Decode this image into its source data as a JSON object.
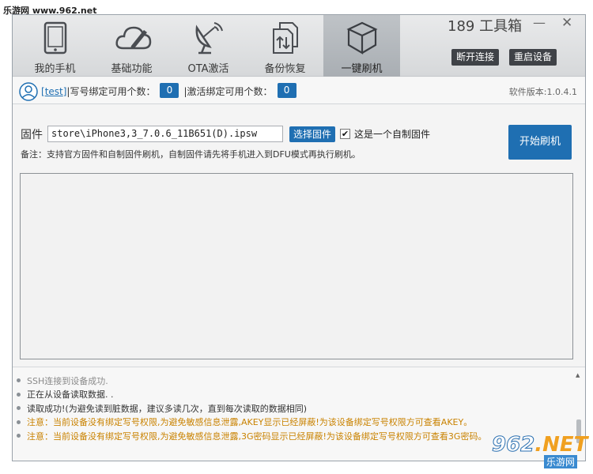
{
  "site_watermark": "乐游网 www.962.net",
  "app": {
    "title": "189 工具箱",
    "minimize_glyph": "—",
    "close_glyph": "✕",
    "disconnect_label": "断开连接",
    "reboot_label": "重启设备"
  },
  "nav": {
    "items": [
      {
        "label": "我的手机",
        "icon": "phone-icon"
      },
      {
        "label": "基础功能",
        "icon": "cloud-pencil-icon"
      },
      {
        "label": "OTA激活",
        "icon": "satellite-dish-icon"
      },
      {
        "label": "备份恢复",
        "icon": "backup-files-icon"
      },
      {
        "label": "一键刷机",
        "icon": "box-icon",
        "active": true
      }
    ]
  },
  "infobar": {
    "bracket_open": "[",
    "username": "test",
    "bracket_close": "]",
    "write_label": "|写号绑定可用个数：",
    "write_count": "0",
    "activate_label": "|激活绑定可用个数：",
    "activate_count": "0",
    "version": "软件版本:1.0.4.1"
  },
  "firmware": {
    "label": "固件",
    "path": "store\\iPhone3,3_7.0.6_11B651(D).ipsw",
    "choose_label": "选择固件",
    "custom_checked": true,
    "check_glyph": "✔",
    "custom_label": "这是一个自制固件",
    "note": "备注：支持官方固件和自制固件刷机，自制固件请先将手机进入到DFU模式再执行刷机。",
    "start_label": "开始刷机"
  },
  "log": [
    {
      "text": "SSH连接到设备成功.",
      "level": "grey"
    },
    {
      "text": "正在从设备读取数据. .",
      "level": "normal"
    },
    {
      "text": "读取成功!(为避免读到脏数据，建议多读几次，直到每次读取的数据相同)",
      "level": "normal"
    },
    {
      "text": "注意：当前设备没有绑定写号权限,为避免敏感信息泄露,AKEY显示已经屏蔽!为该设备绑定写号权限方可查看AKEY。",
      "level": "warn"
    },
    {
      "text": "注意：当前设备没有绑定写号权限,为避免敏感信息泄露,3G密码显示已经屏蔽!为该设备绑定写号权限方可查看3G密码。",
      "level": "warn"
    }
  ],
  "brand_watermark": {
    "big_a": "962",
    "big_b": ".NET",
    "small": "乐游网"
  },
  "colors": {
    "accent": "#1f6fb2",
    "warn": "#c98200",
    "dark_button": "#3f4247"
  }
}
